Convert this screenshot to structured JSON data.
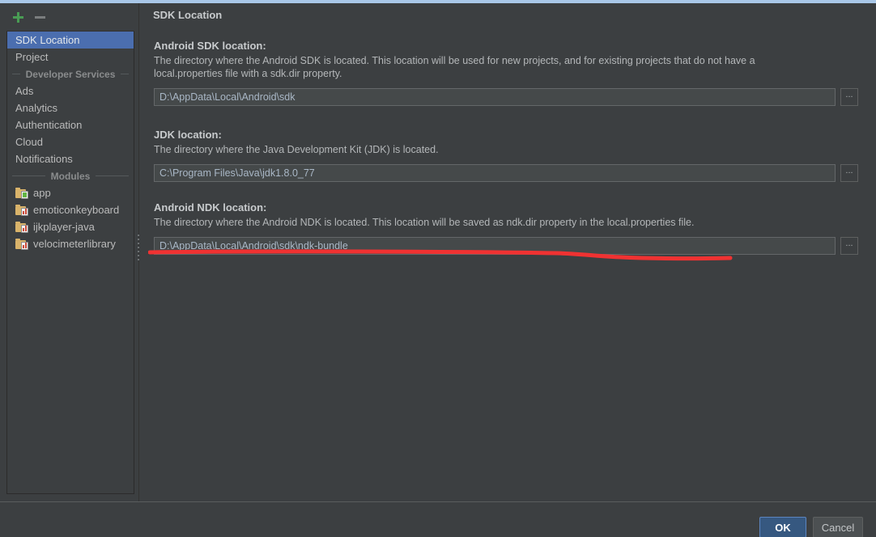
{
  "window": {
    "accent_top_bar_color": "#a9c7e8",
    "background_color": "#3c3f41"
  },
  "toolbar": {
    "add_label": "+",
    "remove_label": "−",
    "add_icon": "plus-icon",
    "remove_icon": "minus-icon"
  },
  "sidebar": {
    "items": [
      {
        "label": "SDK Location",
        "selected": true
      },
      {
        "label": "Project",
        "selected": false
      }
    ],
    "developer_services": {
      "group_label": "Developer Services",
      "items": [
        {
          "label": "Ads"
        },
        {
          "label": "Analytics"
        },
        {
          "label": "Authentication"
        },
        {
          "label": "Cloud"
        },
        {
          "label": "Notifications"
        }
      ]
    },
    "modules": {
      "group_label": "Modules",
      "items": [
        {
          "label": "app",
          "icon": "android-module-icon"
        },
        {
          "label": "emoticonkeyboard",
          "icon": "library-module-icon"
        },
        {
          "label": "ijkplayer-java",
          "icon": "library-module-icon"
        },
        {
          "label": "velocimeterlibrary",
          "icon": "library-module-icon"
        }
      ]
    }
  },
  "main": {
    "page_title": "SDK Location",
    "sections": [
      {
        "title": "Android SDK location:",
        "description": "The directory where the Android SDK is located. This location will be used for new projects, and for existing projects that do not have a local.properties file with a sdk.dir property.",
        "value": "D:\\AppData\\Local\\Android\\sdk",
        "browse_label": "..."
      },
      {
        "title": "JDK location:",
        "description": "The directory where the Java Development Kit (JDK) is located.",
        "value": "C:\\Program Files\\Java\\jdk1.8.0_77",
        "browse_label": "..."
      },
      {
        "title": "Android NDK location:",
        "description": "The directory where the Android NDK is located. This location will be saved as ndk.dir property in the local.properties file.",
        "value": "D:\\AppData\\Local\\Android\\sdk\\ndk-bundle",
        "browse_label": "..."
      }
    ]
  },
  "annotation": {
    "color": "#f03232",
    "shape": "hand-drawn-underline"
  },
  "footer": {
    "ok_label": "OK",
    "cancel_label": "Cancel",
    "ok_color": "#365880"
  }
}
